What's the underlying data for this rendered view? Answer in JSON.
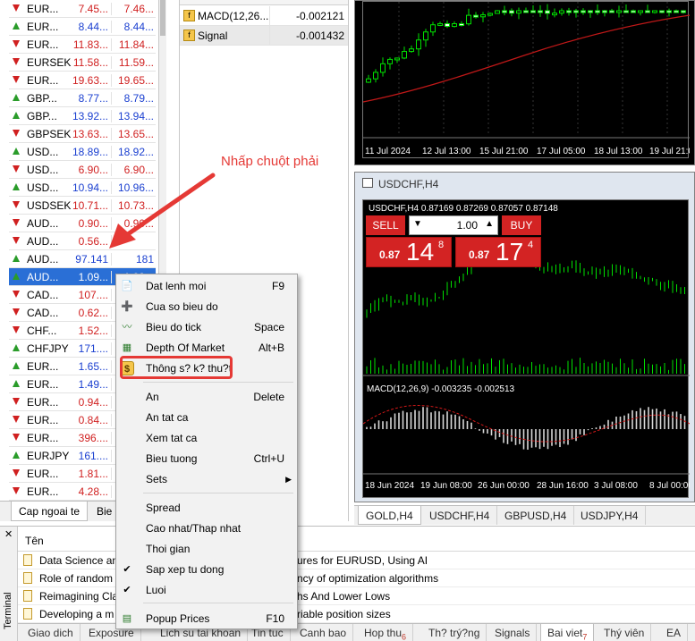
{
  "market_watch": {
    "rows": [
      {
        "sym": "EUR...",
        "bid": "7.45...",
        "ask": "7.46...",
        "dir": "dn"
      },
      {
        "sym": "EUR...",
        "bid": "8.44...",
        "ask": "8.44...",
        "dir": "up"
      },
      {
        "sym": "EUR...",
        "bid": "11.83...",
        "ask": "11.84...",
        "dir": "dn"
      },
      {
        "sym": "EURSEK",
        "bid": "11.58...",
        "ask": "11.59...",
        "dir": "dn"
      },
      {
        "sym": "EUR...",
        "bid": "19.63...",
        "ask": "19.65...",
        "dir": "dn"
      },
      {
        "sym": "GBP...",
        "bid": "8.77...",
        "ask": "8.79...",
        "dir": "up"
      },
      {
        "sym": "GBP...",
        "bid": "13.92...",
        "ask": "13.94...",
        "dir": "up"
      },
      {
        "sym": "GBPSEK",
        "bid": "13.63...",
        "ask": "13.65...",
        "dir": "dn"
      },
      {
        "sym": "USD...",
        "bid": "18.89...",
        "ask": "18.92...",
        "dir": "up"
      },
      {
        "sym": "USD...",
        "bid": "6.90...",
        "ask": "6.90...",
        "dir": "dn"
      },
      {
        "sym": "USD...",
        "bid": "10.94...",
        "ask": "10.96...",
        "dir": "up"
      },
      {
        "sym": "USDSEK",
        "bid": "10.71...",
        "ask": "10.73...",
        "dir": "dn"
      },
      {
        "sym": "AUD...",
        "bid": "0.90...",
        "ask": "0.90...",
        "dir": "dn"
      },
      {
        "sym": "AUD...",
        "bid": "0.56...",
        "ask": "",
        "dir": "dn"
      },
      {
        "sym": "AUD...",
        "bid": "97.141",
        "ask": "181",
        "dir": "up"
      },
      {
        "sym": "AUD...",
        "bid": "1.09...",
        "ask": "1.09...",
        "dir": "up",
        "selected": true
      },
      {
        "sym": "CAD...",
        "bid": "107....",
        "ask": "",
        "dir": "dn"
      },
      {
        "sym": "CAD...",
        "bid": "0.62...",
        "ask": "",
        "dir": "dn"
      },
      {
        "sym": "CHF...",
        "bid": "1.52...",
        "ask": "",
        "dir": "dn"
      },
      {
        "sym": "CHFJPY",
        "bid": "171....",
        "ask": "",
        "dir": "up"
      },
      {
        "sym": "EUR...",
        "bid": "1.65...",
        "ask": "",
        "dir": "up"
      },
      {
        "sym": "EUR...",
        "bid": "1.49...",
        "ask": "",
        "dir": "up"
      },
      {
        "sym": "EUR...",
        "bid": "0.94...",
        "ask": "",
        "dir": "dn"
      },
      {
        "sym": "EUR...",
        "bid": "0.84...",
        "ask": "",
        "dir": "dn"
      },
      {
        "sym": "EUR...",
        "bid": "396....",
        "ask": "",
        "dir": "dn"
      },
      {
        "sym": "EURJPY",
        "bid": "161....",
        "ask": "",
        "dir": "up"
      },
      {
        "sym": "EUR...",
        "bid": "1.81...",
        "ask": "",
        "dir": "dn"
      },
      {
        "sym": "EUR...",
        "bid": "4.28...",
        "ask": "",
        "dir": "dn"
      }
    ],
    "tabs": [
      "Cap ngoai te",
      "Bie"
    ]
  },
  "data_window": {
    "rows": [
      {
        "name": "MACD(12,26...",
        "value": "-0.002121"
      },
      {
        "name": "Signal",
        "value": "-0.001432"
      }
    ]
  },
  "chart1": {
    "time_labels": [
      "11 Jul 2024",
      "12 Jul 13:00",
      "15 Jul 21:00",
      "17 Jul 05:00",
      "18 Jul 13:00",
      "19 Jul 21:00"
    ]
  },
  "chart2": {
    "title": "USDCHF,H4",
    "info": "USDCHF,H4  0.87169 0.87269 0.87057 0.87148",
    "sell_label": "SELL",
    "buy_label": "BUY",
    "volume": "1.00",
    "sell_small": "0.87",
    "sell_big": "14",
    "sell_sup": "8",
    "buy_small": "0.87",
    "buy_big": "17",
    "buy_sup": "4",
    "macd_label": "MACD(12,26,9) -0.003235 -0.002513",
    "time_labels": [
      "18 Jun 2024",
      "19 Jun 08:00",
      "26 Jun 00:00",
      "28 Jun 16:00",
      "3 Jul 08:00",
      "8 Jul 00:00"
    ]
  },
  "chart_tabs": [
    "GOLD,H4",
    "USDCHF,H4",
    "GBPUSD,H4",
    "USDJPY,H4"
  ],
  "terminal": {
    "side_label": "Terminal",
    "header": "Tên",
    "rows": [
      {
        "left": "Data Science an",
        "right": "ures for EURUSD, Using AI"
      },
      {
        "left": "Role of random",
        "right": "ncy of optimization algorithms"
      },
      {
        "left": "Reimagining Cla",
        "right": "hs And Lower Lows"
      },
      {
        "left": "Developing a m",
        "right": "riable position sizes"
      }
    ],
    "tabs": [
      {
        "label": "Giao dich",
        "count": ""
      },
      {
        "label": "Exposure",
        "count": ""
      },
      {
        "label": "Lich su tai khoan",
        "count": ""
      },
      {
        "label": "Tin tuc",
        "count": ""
      },
      {
        "label": "Canh bao",
        "count": ""
      },
      {
        "label": "Hop thu",
        "count": "6"
      },
      {
        "label": "Th? trý?ng",
        "count": ""
      },
      {
        "label": "Signals",
        "count": ""
      },
      {
        "label": "Bai viet",
        "count": "7"
      },
      {
        "label": "Thý viên",
        "count": ""
      },
      {
        "label": "EA",
        "count": ""
      }
    ]
  },
  "context_menu": {
    "items": [
      {
        "label": "Dat lenh moi",
        "shortcut": "F9",
        "icon": "new-order-icon"
      },
      {
        "label": "Cua so bieu do",
        "shortcut": "",
        "icon": "chart-window-icon"
      },
      {
        "label": "Bieu do tick",
        "shortcut": "Space",
        "icon": "tick-chart-icon"
      },
      {
        "label": "Depth Of Market",
        "shortcut": "Alt+B",
        "icon": "depth-of-market-icon"
      },
      {
        "label": "Thông s? k? thu?t",
        "shortcut": "",
        "icon": "specification-icon"
      },
      {
        "label": "An",
        "shortcut": "Delete",
        "icon": ""
      },
      {
        "label": "An tat ca",
        "shortcut": "",
        "icon": ""
      },
      {
        "label": "Xem tat ca",
        "shortcut": "",
        "icon": ""
      },
      {
        "label": "Bieu tuong",
        "shortcut": "Ctrl+U",
        "icon": ""
      },
      {
        "label": "Sets",
        "shortcut": "",
        "icon": ""
      },
      {
        "label": "Spread",
        "shortcut": "",
        "icon": ""
      },
      {
        "label": "Cao nhat/Thap nhat",
        "shortcut": "",
        "icon": ""
      },
      {
        "label": "Thoi gian",
        "shortcut": "",
        "icon": ""
      },
      {
        "label": "Sap xep tu dong",
        "shortcut": "",
        "icon": "check-icon"
      },
      {
        "label": "Luoi",
        "shortcut": "",
        "icon": "check-icon"
      },
      {
        "label": "Popup Prices",
        "shortcut": "F10",
        "icon": "popup-prices-icon"
      }
    ]
  },
  "annotation": {
    "text": "Nhấp chuột phải",
    "color": "#e53935"
  },
  "colors": {
    "up": "#1a3fd0",
    "down": "#d02020",
    "selected": "#2a6fd6",
    "trade_red": "#d32323",
    "candle": "#00e000"
  }
}
